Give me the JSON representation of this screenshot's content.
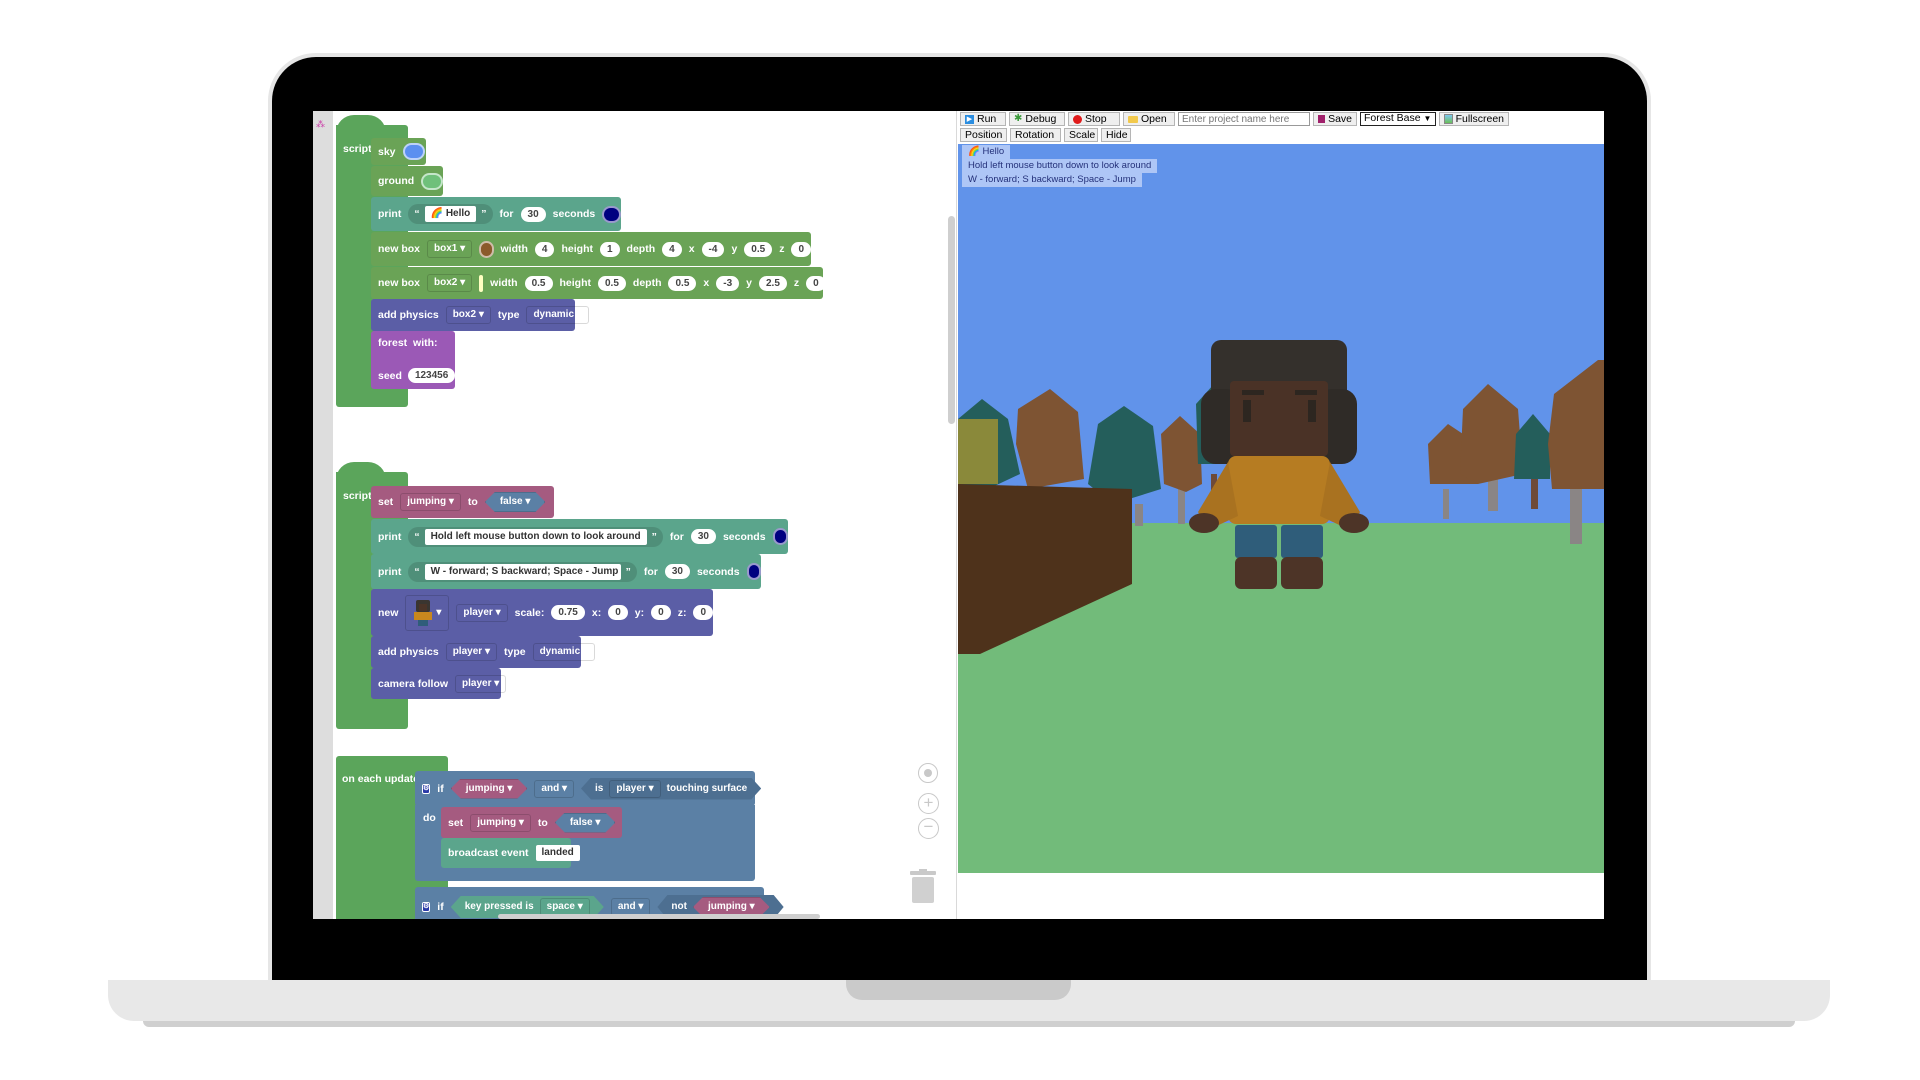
{
  "editor": {
    "script1": {
      "hat_label": "script",
      "sky_label": "sky",
      "sky_color": "#5b8ff0",
      "ground_label": "ground",
      "ground_color": "#6fc07a",
      "print": {
        "label": "print",
        "text": "Hello",
        "text_icon": "rainbow",
        "for": "for",
        "seconds_value": "30",
        "seconds_label": "seconds",
        "color": "#000080"
      },
      "box1": {
        "label": "new box",
        "name": "box1",
        "color": "#8b5a2b",
        "width_label": "width",
        "width": "4",
        "height_label": "height",
        "height": "1",
        "depth_label": "depth",
        "depth": "4",
        "x_label": "x",
        "x": "-4",
        "y_label": "y",
        "y": "0.5",
        "z_label": "z",
        "z": "0"
      },
      "box2": {
        "label": "new box",
        "name": "box2",
        "color": "#ffff66",
        "width_label": "width",
        "width": "0.5",
        "height_label": "height",
        "height": "0.5",
        "depth_label": "depth",
        "depth": "0.5",
        "x_label": "x",
        "x": "-3",
        "y_label": "y",
        "y": "2.5",
        "z_label": "z",
        "z": "0"
      },
      "physics": {
        "label": "add physics",
        "target": "box2",
        "type_label": "type",
        "type": "dynamic"
      },
      "forest": {
        "label": "forest",
        "with_label": "with:",
        "seed_label": "seed",
        "seed": "123456"
      }
    },
    "script2": {
      "hat_label": "script",
      "set": {
        "label": "set",
        "var": "jumping",
        "to": "to",
        "value": "false"
      },
      "print1": {
        "label": "print",
        "text": "Hold left mouse button down to look around",
        "for": "for",
        "seconds_value": "30",
        "seconds_label": "seconds",
        "color": "#000080"
      },
      "print2": {
        "label": "print",
        "text": "W - forward; S backward; Space - Jump",
        "for": "for",
        "seconds_value": "30",
        "seconds_label": "seconds",
        "color": "#000080"
      },
      "new": {
        "label": "new",
        "name": "player",
        "scale_label": "scale:",
        "scale": "0.75",
        "x_label": "x:",
        "x": "0",
        "y_label": "y:",
        "y": "0",
        "z_label": "z:",
        "z": "0"
      },
      "physics": {
        "label": "add physics",
        "target": "player",
        "type_label": "type",
        "type": "dynamic"
      },
      "camera": {
        "label": "camera follow",
        "target": "player"
      }
    },
    "update": {
      "hat_label": "on each update",
      "if1": {
        "label": "if",
        "cond_var": "jumping",
        "op": "and",
        "is_label": "is",
        "is_target": "player",
        "touching": "touching surface"
      },
      "do_label": "do",
      "set": {
        "label": "set",
        "var": "jumping",
        "to": "to",
        "value": "false"
      },
      "broadcast": {
        "label": "broadcast event",
        "event": "landed"
      },
      "if2": {
        "label": "if",
        "key_label": "key pressed is",
        "key": "space",
        "op": "and",
        "not_label": "not",
        "var": "jumping"
      }
    }
  },
  "toolbar": {
    "run": "Run",
    "debug": "Debug",
    "stop": "Stop",
    "open": "Open",
    "project_placeholder": "Enter project name here",
    "save": "Save",
    "scene_select": "Forest Base",
    "fullscreen": "Fullscreen",
    "position": "Position",
    "rotation": "Rotation",
    "scale": "Scale",
    "hide": "Hide"
  },
  "canvas": {
    "messages": [
      "Hello",
      "Hold left mouse button down to look around",
      "W - forward; S backward; Space - Jump"
    ],
    "sky_color": "#6193ea",
    "ground_color": "#72bb7a"
  }
}
